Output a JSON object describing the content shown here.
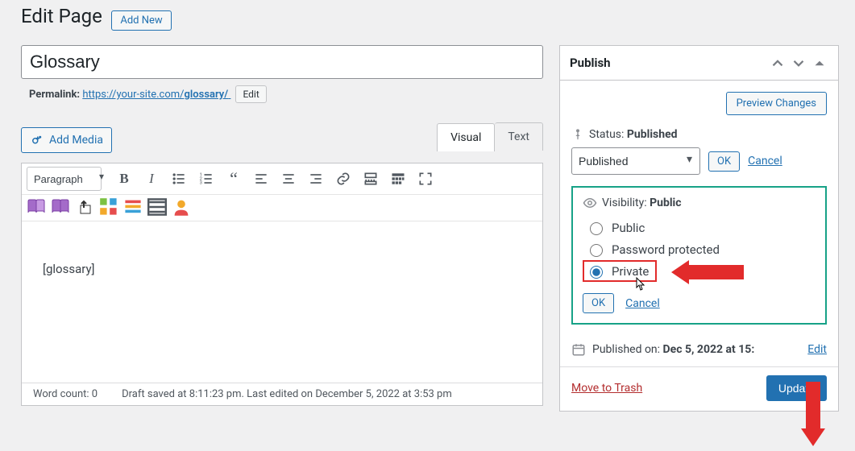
{
  "heading": "Edit Page",
  "add_new": "Add New",
  "title_value": "Glossary",
  "permalink": {
    "label": "Permalink:",
    "url": "https://your-site.com/",
    "slug": "glossary/",
    "edit": "Edit"
  },
  "media_button": "Add Media",
  "tabs": {
    "visual": "Visual",
    "text": "Text"
  },
  "format_select": "Paragraph",
  "editor_body": "[glossary]",
  "status_bar": {
    "word_count_label": "Word count:",
    "word_count": "0",
    "autosave": "Draft saved at 8:11:23 pm. Last edited on December 5, 2022 at 3:53 pm"
  },
  "publish": {
    "box_title": "Publish",
    "preview": "Preview Changes",
    "status_label": "Status:",
    "status_value": "Published",
    "status_select": "Published",
    "ok": "OK",
    "cancel": "Cancel",
    "visibility_label": "Visibility:",
    "visibility_value": "Public",
    "options": {
      "public": "Public",
      "password": "Password protected",
      "private": "Private"
    },
    "published_on": "Published on:",
    "published_date": "Dec 5, 2022 at 15:",
    "edit_link": "Edit",
    "trash": "Move to Trash",
    "update": "Update"
  }
}
